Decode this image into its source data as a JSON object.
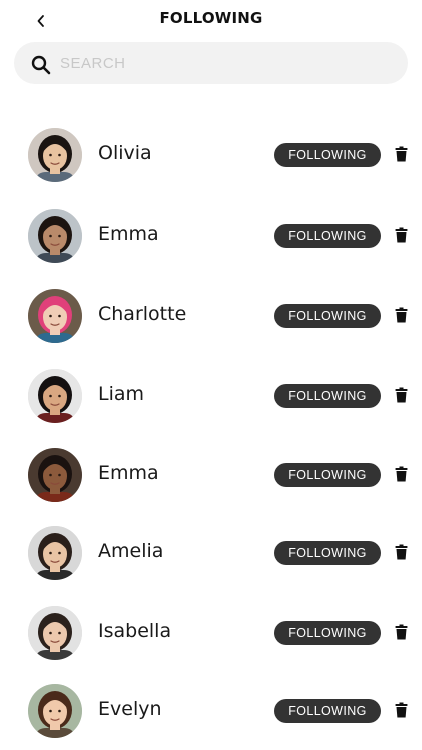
{
  "header": {
    "title": "FOLLOWING",
    "back_icon": "chevron-left-icon"
  },
  "search": {
    "placeholder": "SEARCH",
    "value": "",
    "icon": "search-icon"
  },
  "following": [
    {
      "name": "Olivia",
      "button_label": "FOLLOWING",
      "skin": "#e8c3a0",
      "hair": "#1a1411",
      "bg": "#cfc7c0",
      "shirt": "#5a6a7a"
    },
    {
      "name": "Emma",
      "button_label": "FOLLOWING",
      "skin": "#b98a6a",
      "hair": "#1c1410",
      "bg": "#bcc3c8",
      "shirt": "#3f4a56"
    },
    {
      "name": "Charlotte",
      "button_label": "FOLLOWING",
      "skin": "#f0cdb6",
      "hair": "#e0407a",
      "bg": "#6b5b4a",
      "shirt": "#2d6a8f"
    },
    {
      "name": "Liam",
      "button_label": "FOLLOWING",
      "skin": "#d9a781",
      "hair": "#141010",
      "bg": "#e6e6e6",
      "shirt": "#6a1f1f"
    },
    {
      "name": "Emma",
      "button_label": "FOLLOWING",
      "skin": "#8c5a3c",
      "hair": "#1a1210",
      "bg": "#4a3a30",
      "shirt": "#7a2a1a"
    },
    {
      "name": "Amelia",
      "button_label": "FOLLOWING",
      "skin": "#e9c4a4",
      "hair": "#2a1f1a",
      "bg": "#d8d8d8",
      "shirt": "#2a2a2a"
    },
    {
      "name": "Isabella",
      "button_label": "FOLLOWING",
      "skin": "#ecc8ad",
      "hair": "#2b211c",
      "bg": "#e2e2e2",
      "shirt": "#3a3a3a"
    },
    {
      "name": "Evelyn",
      "button_label": "FOLLOWING",
      "skin": "#f0c9ab",
      "hair": "#4a2a1a",
      "bg": "#a7b7a1",
      "shirt": "#5a4a3a"
    }
  ],
  "icons": {
    "delete": "trash-icon"
  },
  "colors": {
    "button_bg": "#333333",
    "button_text": "#ffffff",
    "search_bg": "#f2f2f2"
  }
}
